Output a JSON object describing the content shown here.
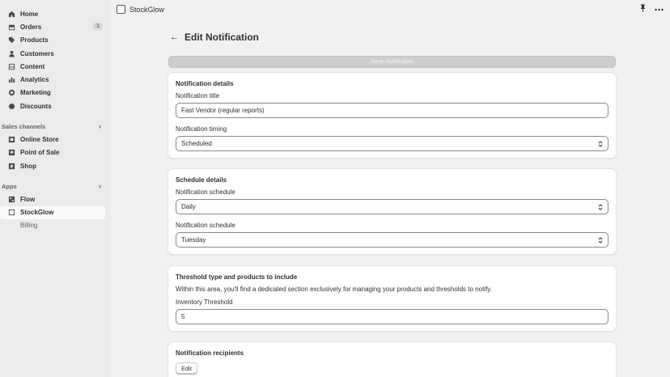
{
  "sidebar": {
    "items": [
      {
        "label": "Home",
        "icon": "home-icon"
      },
      {
        "label": "Orders",
        "icon": "orders-icon",
        "badge": "1"
      },
      {
        "label": "Products",
        "icon": "tag-icon"
      },
      {
        "label": "Customers",
        "icon": "person-icon"
      },
      {
        "label": "Content",
        "icon": "content-icon"
      },
      {
        "label": "Analytics",
        "icon": "bar-chart-icon"
      },
      {
        "label": "Marketing",
        "icon": "target-icon"
      },
      {
        "label": "Discounts",
        "icon": "discount-icon"
      }
    ],
    "sales_channels": {
      "heading": "Sales channels",
      "items": [
        {
          "label": "Online Store",
          "icon": "store-icon"
        },
        {
          "label": "Point of Sale",
          "icon": "pos-icon"
        },
        {
          "label": "Shop",
          "icon": "shop-icon"
        }
      ]
    },
    "apps": {
      "heading": "Apps",
      "items": [
        {
          "label": "Flow",
          "icon": "flow-icon"
        },
        {
          "label": "StockGlow",
          "icon": "app-square-icon"
        }
      ],
      "sub_items": [
        {
          "label": "Billing"
        }
      ]
    }
  },
  "topbar": {
    "app_name": "StockGlow",
    "pin_icon": "pin-icon",
    "more_icon": "more-horizontal-icon"
  },
  "page": {
    "title": "Edit Notification",
    "save_label": "Save Notification"
  },
  "cards": {
    "details": {
      "title": "Notification details",
      "title_label": "Notification title",
      "title_value": "Fast Vendor (regular reports)",
      "timing_label": "Notification timing",
      "timing_value": "Scheduled"
    },
    "schedule": {
      "title": "Schedule details",
      "schedule_label_1": "Notification schedule",
      "schedule_value_1": "Daily",
      "schedule_label_2": "Notification schedule",
      "schedule_value_2": "Tuesday"
    },
    "threshold": {
      "title": "Threshold type and products to include",
      "description": "Within this area, you'll find a dedicated section exclusively for managing your products and thresholds to notify.",
      "threshold_label": "Inventory Threshold",
      "threshold_value": "5"
    },
    "recipients": {
      "title": "Notification recipients",
      "edit_label": "Edit"
    }
  }
}
